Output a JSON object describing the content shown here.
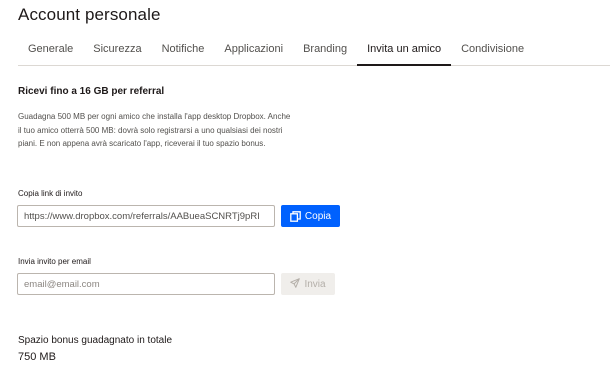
{
  "header": {
    "title": "Account personale"
  },
  "tabs": [
    {
      "label": "Generale"
    },
    {
      "label": "Sicurezza"
    },
    {
      "label": "Notifiche"
    },
    {
      "label": "Applicazioni"
    },
    {
      "label": "Branding"
    },
    {
      "label": "Invita un amico",
      "active": true
    },
    {
      "label": "Condivisione"
    }
  ],
  "referral": {
    "title": "Ricevi fino a 16 GB per referral",
    "description": "Guadagna 500 MB per ogni amico che installa l'app desktop Dropbox. Anche il tuo amico otterrà 500 MB: dovrà solo registrarsi a uno qualsiasi dei nostri piani. E non appena avrà scaricato l'app, riceverai il tuo spazio bonus."
  },
  "copy_link": {
    "label": "Copia link di invito",
    "value": "https://www.dropbox.com/referrals/AABueaSCNRTj9pRI",
    "button_label": "Copia",
    "button_icon": "copy-icon"
  },
  "email_invite": {
    "label": "Invia invito per email",
    "placeholder": "email@email.com",
    "button_label": "Invia",
    "button_icon": "send-icon"
  },
  "bonus": {
    "title": "Spazio bonus guadagnato in totale",
    "value": "750 MB"
  },
  "colors": {
    "primary_button": "#0061fe",
    "disabled_button_bg": "#f0eeeb",
    "disabled_button_text": "#b4afa9",
    "text": "#1e1919",
    "muted_text": "#52504d"
  }
}
